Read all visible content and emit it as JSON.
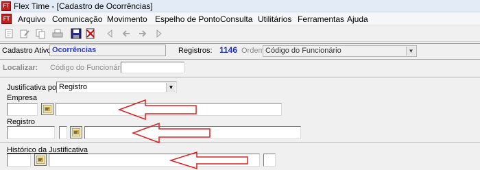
{
  "window": {
    "title": "Flex Time - [Cadastro de Ocorrências]"
  },
  "menu": [
    "Arquivo",
    "Comunicação",
    "Movimento",
    "Espelho de Ponto",
    "Consulta",
    "Utilitários",
    "Ferramentas",
    "Ajuda"
  ],
  "toolbar": {
    "icons": [
      "new-record-icon",
      "edit-record-icon",
      "copy-record-icon",
      "print-icon",
      "save-icon",
      "cancel-icon",
      "first-record-icon",
      "previous-record-icon",
      "next-record-icon",
      "last-record-icon"
    ]
  },
  "status": {
    "cadastro_label": "Cadastro Ativo:",
    "cadastro_value": "Ocorrências",
    "registros_label": "Registros:",
    "registros_value": "1146",
    "ordem_label": "Ordem",
    "ordem_value": "Código do Funcionário"
  },
  "search": {
    "localizar_label": "Localizar:",
    "field_label": "Código do Funcionário",
    "value": ""
  },
  "form": {
    "justificativa_label": "Justificativa por",
    "justificativa_value": "Registro",
    "empresa_label": "Empresa",
    "empresa_code": "",
    "empresa_name": "",
    "registro_label": "Registro",
    "registro_code": "",
    "registro_digit": "",
    "registro_name": "",
    "historico_label": "Histórico da Justificativa",
    "historico_code": "",
    "historico_desc": "",
    "historico_extra": ""
  },
  "colors": {
    "arrow": "#e02020",
    "value_blue": "#2a3bd6",
    "registros_blue": "#1f2fbd"
  }
}
